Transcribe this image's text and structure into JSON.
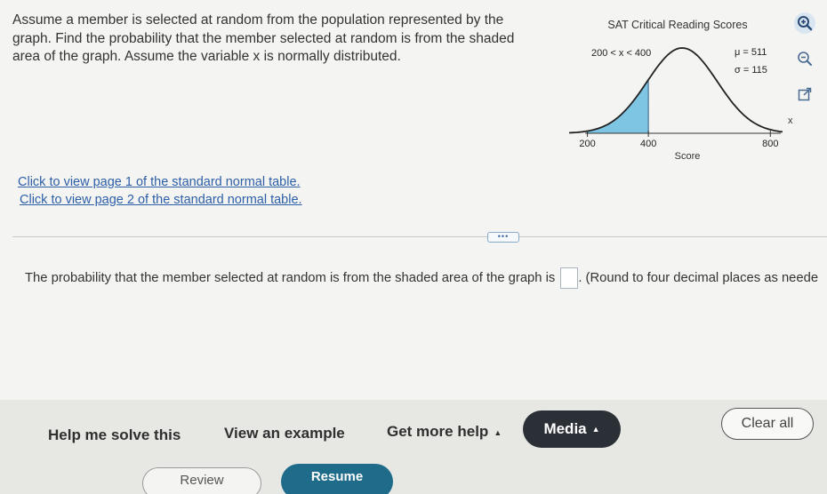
{
  "question": {
    "text": "Assume a member is selected at random from the population represented by the graph. Find the probability that the member selected at random is from the shaded area of the graph. Assume the variable x is normally distributed."
  },
  "links": [
    "Click to view page 1 of the standard normal table.",
    "Click to view page 2 of the standard normal table."
  ],
  "graph": {
    "title": "SAT Critical Reading Scores",
    "interval_label": "200 < x < 400",
    "mu_label": "μ = 511",
    "sigma_label": "σ = 115",
    "x_axis_label": "x",
    "xlabel": "Score",
    "tick_labels": [
      "200",
      "400",
      "800"
    ],
    "mu": 511,
    "sigma": 115,
    "shade_from": 200,
    "shade_to": 400,
    "colors": {
      "shade": "#7ec5e3",
      "curve": "#222222"
    }
  },
  "tools": [
    "zoom-in-icon",
    "zoom-out-icon",
    "pop-out-icon"
  ],
  "divider_button": "•••",
  "answer": {
    "prefix": "The probability that the member selected at random is from the shaded area of the graph is",
    "suffix": ". (Round to four decimal places as neede"
  },
  "footer": {
    "help_me_solve": "Help me solve this",
    "view_example": "View an example",
    "get_more_help": "Get more help",
    "media": "Media",
    "clear_all": "Clear all",
    "review": "Review",
    "resume": "Resume"
  }
}
